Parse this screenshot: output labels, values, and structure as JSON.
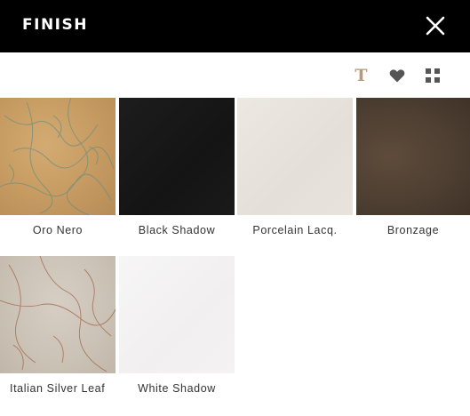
{
  "header": {
    "title": "FINISH",
    "close_icon": "close-icon"
  },
  "toolbar": {
    "text_tool": "T",
    "icons": [
      "text-icon",
      "heart-icon",
      "grid-icon"
    ]
  },
  "colors": {
    "header_bg": "#000000",
    "accent": "#b59a7c",
    "icon_gray": "#555555"
  },
  "finishes": [
    {
      "name": "Oro Nero",
      "swatch": "gold-marbled"
    },
    {
      "name": "Black Shadow",
      "swatch": "black"
    },
    {
      "name": "Porcelain Lacq.",
      "swatch": "off-white"
    },
    {
      "name": "Bronzage",
      "swatch": "dark-bronze"
    },
    {
      "name": "Italian Silver Leaf",
      "swatch": "silver-marbled"
    },
    {
      "name": "White Shadow",
      "swatch": "white"
    }
  ]
}
